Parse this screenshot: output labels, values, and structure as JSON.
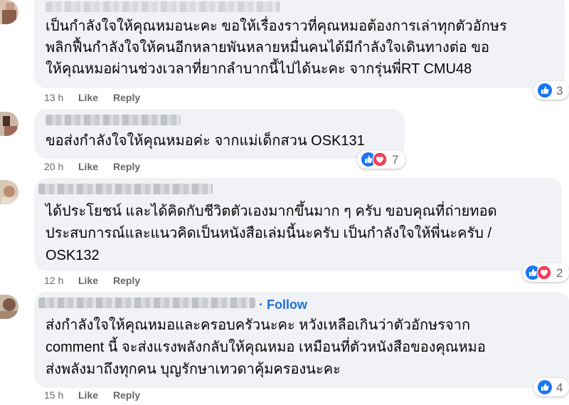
{
  "comments": [
    {
      "text": [
        "เป็นกำลังใจให้คุณหมอนะคะ ขอให้เรื่องราวที่คุณหมอต้องการเล่าทุกตัวอักษร",
        "พลิกฟื้นกำลังใจให้คนอีกหลายพันหลายหมื่นคนได้มีกำลังใจเดินทางต่อ ขอ",
        "ให้คุณหมอผ่านช่วงเวลาที่ยากลำบากนี้ไปได้นะคะ จากรุ่นพี่RT CMU48"
      ],
      "time": "13 h",
      "like_label": "Like",
      "reply_label": "Reply",
      "reactions": [
        "like-icon"
      ],
      "reaction_count": "3"
    },
    {
      "text": [
        "ขอส่งกำลังใจให้คุณหมอค่ะ จากแม่เด็กสวน OSK131"
      ],
      "time": "20 h",
      "like_label": "Like",
      "reply_label": "Reply",
      "reactions": [
        "like-icon",
        "love-icon"
      ],
      "reaction_count": "7"
    },
    {
      "text": [
        "ได้ประโยชน์ และได้คิดกับชีวิตตัวเองมากขึ้นมาก ๆ ครับ ขอบคุณที่ถ่ายทอด",
        "ประสบการณ์และแนวคิดเป็นหนังสือเล่มนี้นะครับ เป็นกำลังใจให้พี่นะครับ /",
        "OSK132"
      ],
      "time": "12 h",
      "like_label": "Like",
      "reply_label": "Reply",
      "reactions": [
        "like-icon",
        "love-icon"
      ],
      "reaction_count": "2"
    },
    {
      "follow_label": "Follow",
      "text": [
        "ส่งกำลังใจให้คุณหมอและครอบครัวนะคะ หวังเหลือเกินว่าตัวอักษรจาก",
        "comment นี้ จะส่งแรงพลังกลับให้คุณหมอ เหมือนที่ตัวหนังสือของคุณหมอ",
        "ส่งพลังมาถึงทุกคน บุญรักษาเทวดาคุ้มครองนะคะ"
      ],
      "time": "15 h",
      "like_label": "Like",
      "reply_label": "Reply",
      "reactions": [
        "like-icon"
      ],
      "reaction_count": "4"
    }
  ],
  "colors": {
    "like_blue": "#1877f2",
    "love_red": "#f33e58",
    "follow_blue": "#216fdb",
    "bubble_bg": "#f0f2f5",
    "meta_gray": "#65676b"
  }
}
